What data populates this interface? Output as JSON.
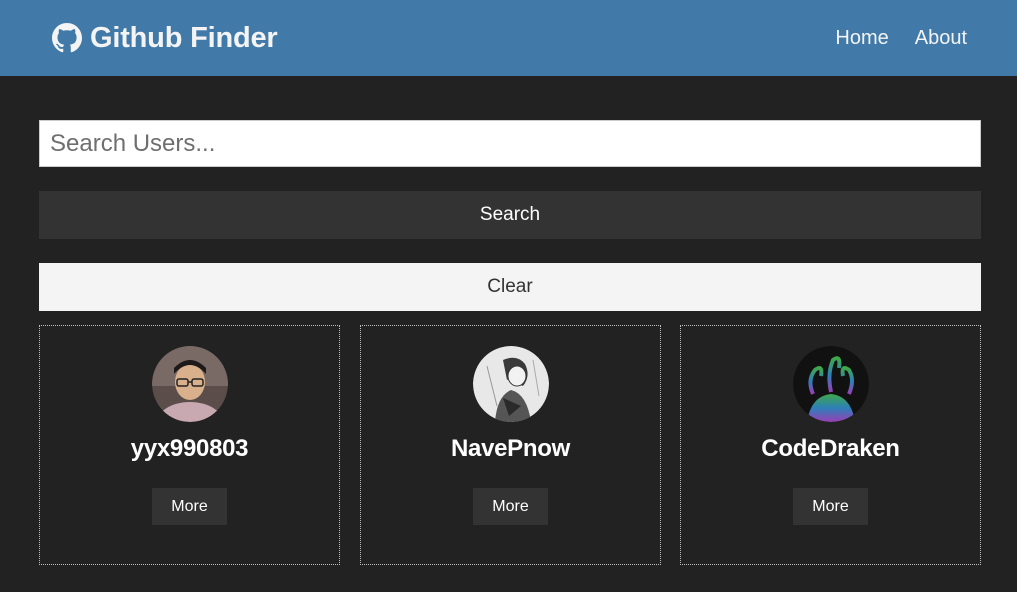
{
  "navbar": {
    "brand_icon": "github-icon",
    "title": "Github Finder",
    "links": [
      {
        "label": "Home"
      },
      {
        "label": "About"
      }
    ]
  },
  "search": {
    "placeholder": "Search Users...",
    "value": "",
    "search_label": "Search",
    "clear_label": "Clear"
  },
  "users": [
    {
      "login": "yyx990803",
      "avatar": "avatar-photo-man-glasses",
      "more_label": "More"
    },
    {
      "login": "NavePnow",
      "avatar": "avatar-sketch-figure",
      "more_label": "More"
    },
    {
      "login": "CodeDraken",
      "avatar": "avatar-colorful-hydra",
      "more_label": "More"
    }
  ],
  "colors": {
    "navbar_bg": "#4179a8",
    "page_bg": "#222222",
    "dark_button": "#333333",
    "light_button": "#f4f4f4"
  }
}
